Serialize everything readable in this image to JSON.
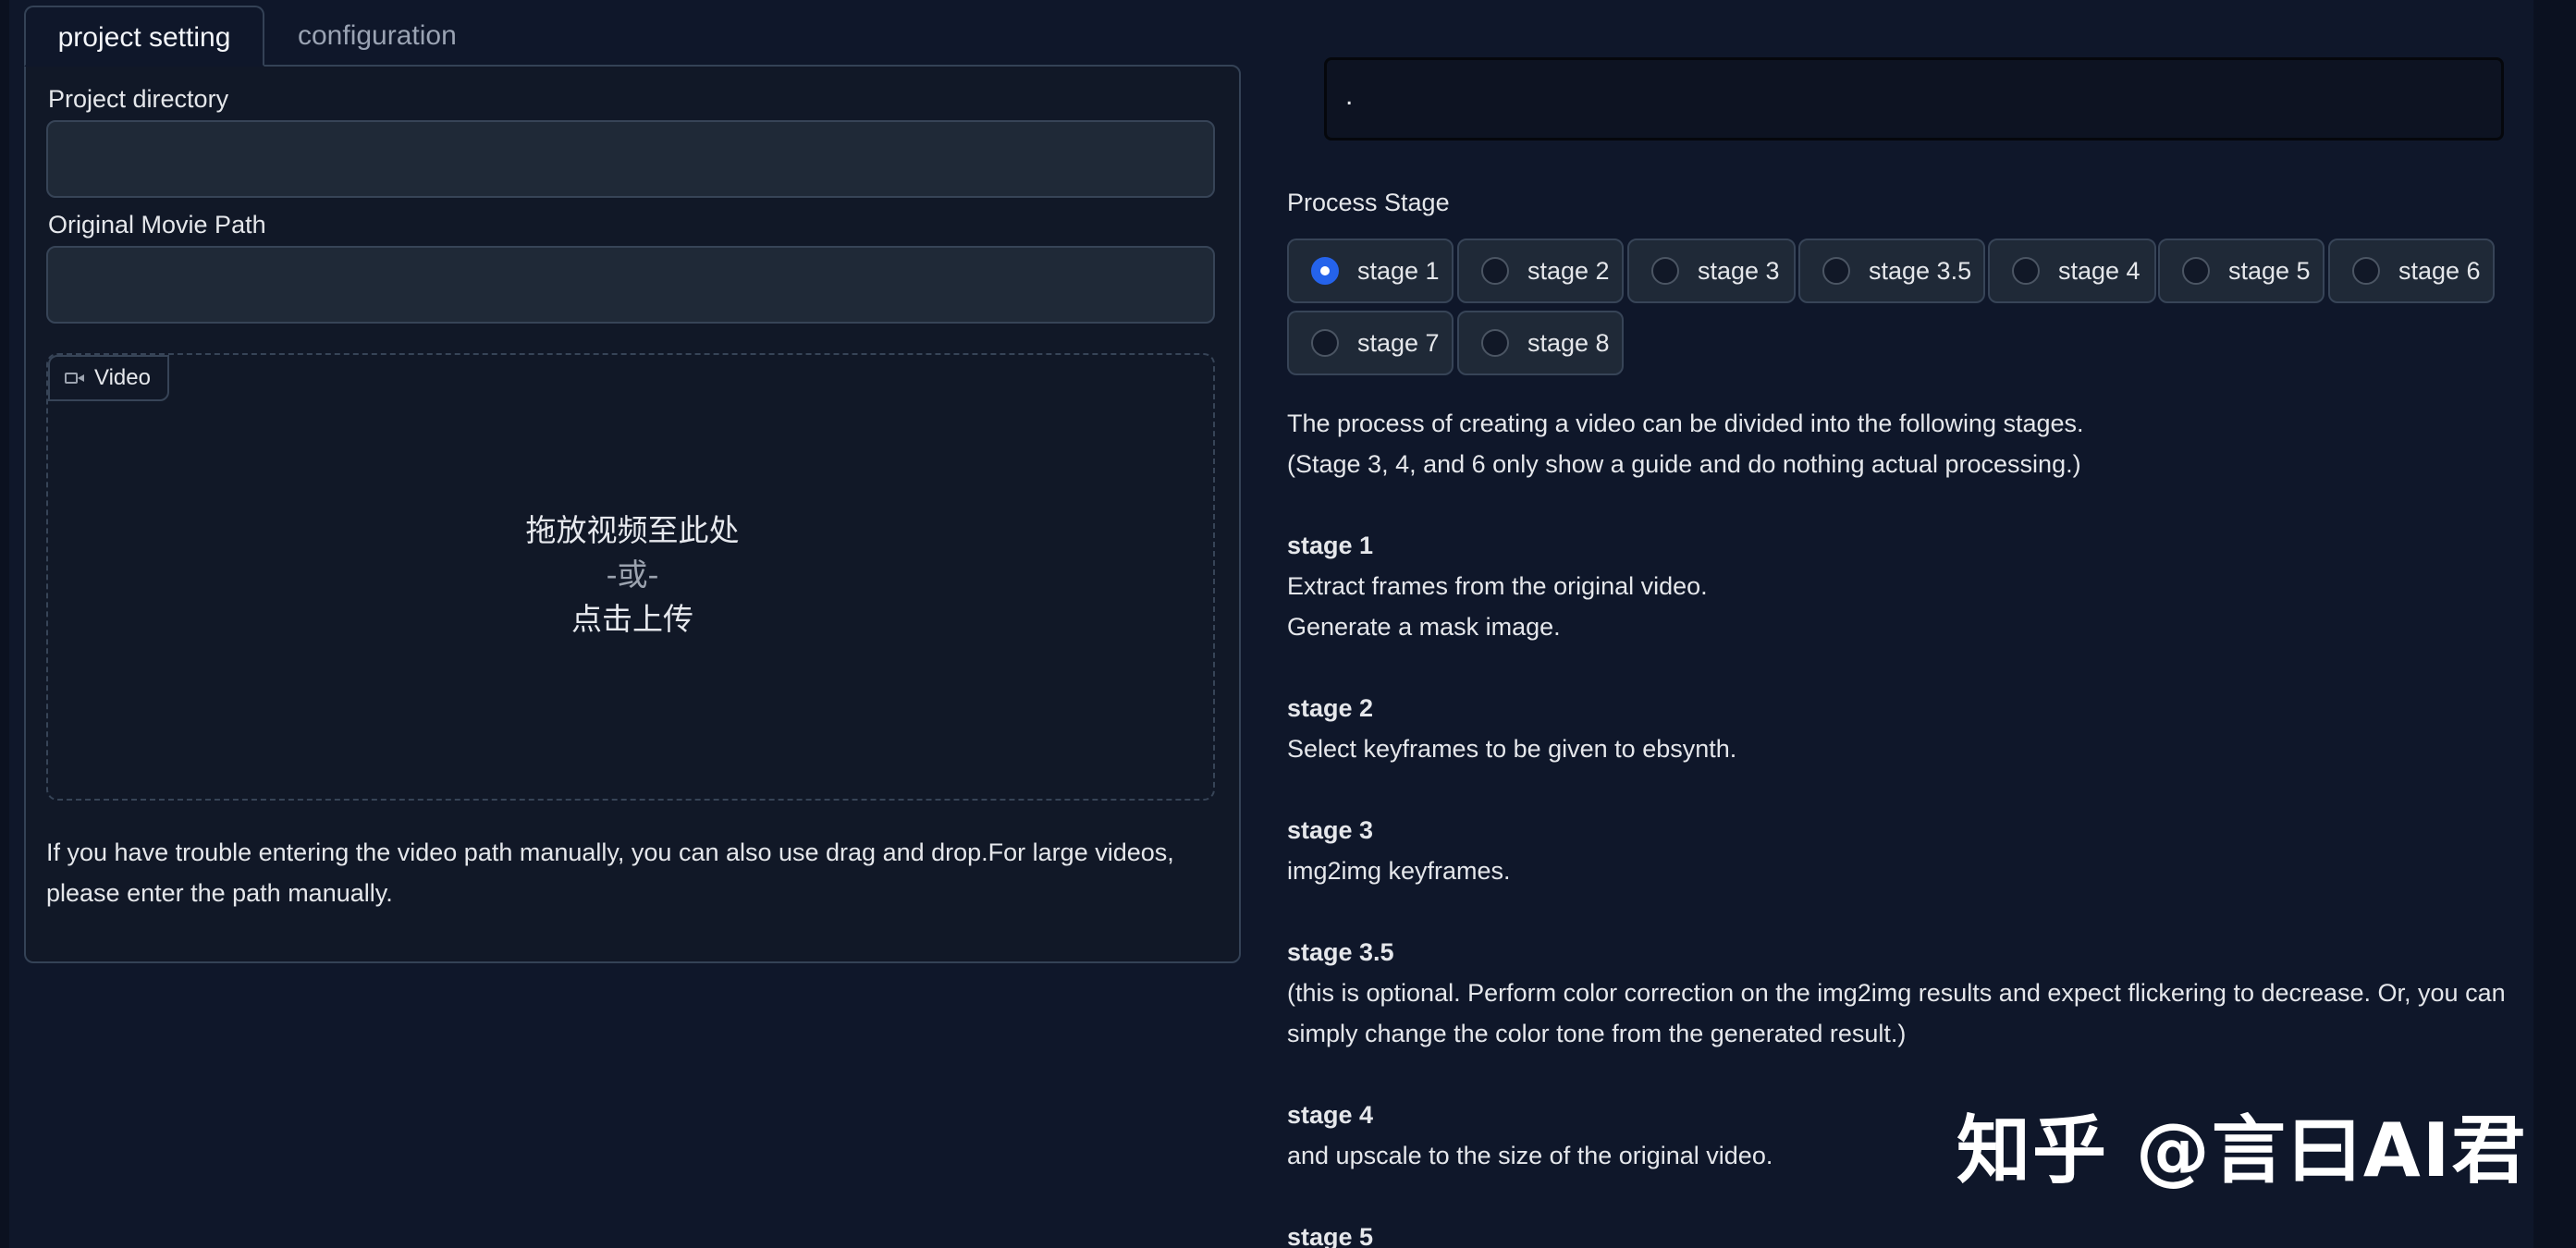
{
  "tabs": [
    {
      "label": "project setting",
      "active": true
    },
    {
      "label": "configuration",
      "active": false
    }
  ],
  "project": {
    "directory_label": "Project directory",
    "directory_value": "",
    "movie_path_label": "Original Movie Path",
    "movie_path_value": "",
    "video_chip": "Video",
    "drop_main": "拖放视频至此处",
    "drop_or": "-或-",
    "drop_click": "点击上传",
    "hint": "If you have trouble entering the video path manually, you can also use drag and drop.For large videos, please enter the path manually."
  },
  "output_text": ".",
  "process_stage": {
    "label": "Process Stage",
    "options": [
      "stage 1",
      "stage 2",
      "stage 3",
      "stage 3.5",
      "stage 4",
      "stage 5",
      "stage 6",
      "stage 7",
      "stage 8"
    ],
    "selected": "stage 1"
  },
  "description": {
    "intro1": "The process of creating a video can be divided into the following stages.",
    "intro2": "(Stage 3, 4, and 6 only show a guide and do nothing actual processing.)",
    "stages": [
      {
        "title": "stage 1",
        "lines": [
          "Extract frames from the original video.",
          "Generate a mask image."
        ]
      },
      {
        "title": "stage 2",
        "lines": [
          "Select keyframes to be given to ebsynth."
        ]
      },
      {
        "title": "stage 3",
        "lines": [
          "img2img keyframes."
        ]
      },
      {
        "title": "stage 3.5",
        "lines": [
          "(this is optional. Perform color correction on the img2img results and expect flickering to decrease. Or, you can simply change the color tone from the generated result.)"
        ]
      },
      {
        "title": "stage 4",
        "lines": [
          "and upscale to the size of the original video."
        ]
      },
      {
        "title": "stage 5",
        "lines": []
      }
    ]
  },
  "watermark": "知乎 @言曰AI君",
  "colors": {
    "background": "#0f172a",
    "panel": "#111827",
    "input": "#1f2937",
    "border": "#374457",
    "accent": "#2563eb"
  }
}
